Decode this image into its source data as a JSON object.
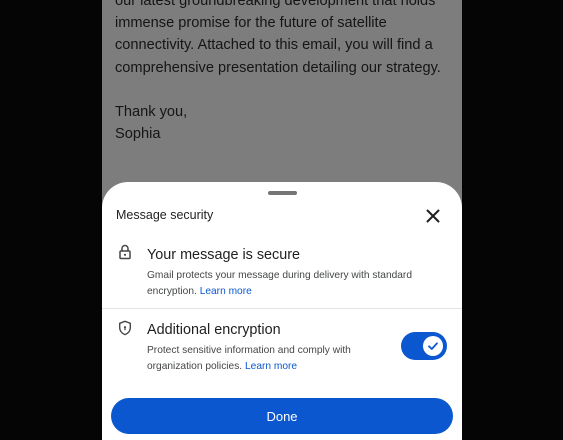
{
  "email": {
    "lines": [
      "our latest groundbreaking development that holds",
      "immense promise for the future of satellite",
      "connectivity. Attached to this email, you will find a",
      "comprehensive presentation detailing our strategy."
    ],
    "signoff": "Thank you,",
    "signature": "Sophia"
  },
  "sheet": {
    "title": "Message security",
    "secure": {
      "title": "Your message is secure",
      "description": "Gmail protects your message during delivery with standard encryption.",
      "link": "Learn more",
      "icon": "lock-icon"
    },
    "encryption": {
      "title": "Additional encryption",
      "description": "Protect sensitive information and comply with organization policies.",
      "link": "Learn more",
      "icon": "shield-icon",
      "enabled": true
    },
    "done_label": "Done"
  },
  "colors": {
    "accent": "#0b57d0",
    "overlay": "#7d7d7d",
    "sheet": "#ffffff"
  }
}
